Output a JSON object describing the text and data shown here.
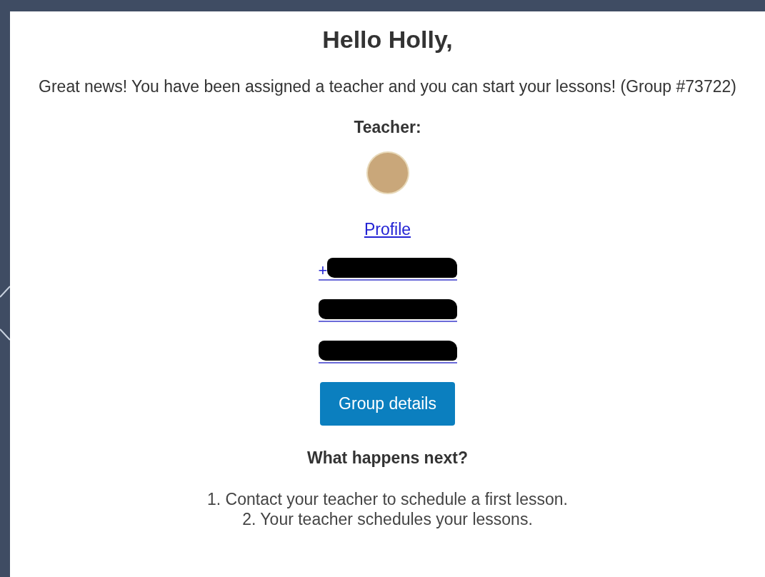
{
  "greeting": "Hello Holly,",
  "intro": "Great news! You have been assigned a teacher and you can start your lessons! (Group #73722)",
  "teacher_label": "Teacher:",
  "profile_link": "Profile",
  "contacts": [
    {
      "prefix": "+",
      "redacted": true
    },
    {
      "redacted": true
    },
    {
      "redacted": true
    }
  ],
  "group_button": "Group details",
  "next_heading": "What happens next?",
  "steps": [
    "1. Contact your teacher to schedule a first lesson.",
    "2. Your teacher schedules your lessons."
  ]
}
